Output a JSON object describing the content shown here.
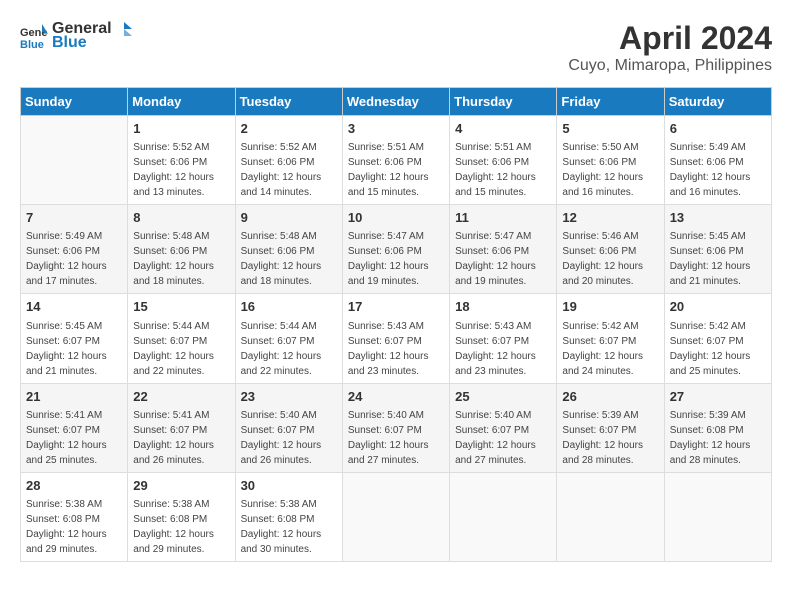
{
  "header": {
    "logo_general": "General",
    "logo_blue": "Blue",
    "title": "April 2024",
    "subtitle": "Cuyo, Mimaropa, Philippines"
  },
  "weekdays": [
    "Sunday",
    "Monday",
    "Tuesday",
    "Wednesday",
    "Thursday",
    "Friday",
    "Saturday"
  ],
  "weeks": [
    [
      {
        "day": "",
        "details": ""
      },
      {
        "day": "1",
        "details": "Sunrise: 5:52 AM\nSunset: 6:06 PM\nDaylight: 12 hours\nand 13 minutes."
      },
      {
        "day": "2",
        "details": "Sunrise: 5:52 AM\nSunset: 6:06 PM\nDaylight: 12 hours\nand 14 minutes."
      },
      {
        "day": "3",
        "details": "Sunrise: 5:51 AM\nSunset: 6:06 PM\nDaylight: 12 hours\nand 15 minutes."
      },
      {
        "day": "4",
        "details": "Sunrise: 5:51 AM\nSunset: 6:06 PM\nDaylight: 12 hours\nand 15 minutes."
      },
      {
        "day": "5",
        "details": "Sunrise: 5:50 AM\nSunset: 6:06 PM\nDaylight: 12 hours\nand 16 minutes."
      },
      {
        "day": "6",
        "details": "Sunrise: 5:49 AM\nSunset: 6:06 PM\nDaylight: 12 hours\nand 16 minutes."
      }
    ],
    [
      {
        "day": "7",
        "details": "Sunrise: 5:49 AM\nSunset: 6:06 PM\nDaylight: 12 hours\nand 17 minutes."
      },
      {
        "day": "8",
        "details": "Sunrise: 5:48 AM\nSunset: 6:06 PM\nDaylight: 12 hours\nand 18 minutes."
      },
      {
        "day": "9",
        "details": "Sunrise: 5:48 AM\nSunset: 6:06 PM\nDaylight: 12 hours\nand 18 minutes."
      },
      {
        "day": "10",
        "details": "Sunrise: 5:47 AM\nSunset: 6:06 PM\nDaylight: 12 hours\nand 19 minutes."
      },
      {
        "day": "11",
        "details": "Sunrise: 5:47 AM\nSunset: 6:06 PM\nDaylight: 12 hours\nand 19 minutes."
      },
      {
        "day": "12",
        "details": "Sunrise: 5:46 AM\nSunset: 6:06 PM\nDaylight: 12 hours\nand 20 minutes."
      },
      {
        "day": "13",
        "details": "Sunrise: 5:45 AM\nSunset: 6:06 PM\nDaylight: 12 hours\nand 21 minutes."
      }
    ],
    [
      {
        "day": "14",
        "details": "Sunrise: 5:45 AM\nSunset: 6:07 PM\nDaylight: 12 hours\nand 21 minutes."
      },
      {
        "day": "15",
        "details": "Sunrise: 5:44 AM\nSunset: 6:07 PM\nDaylight: 12 hours\nand 22 minutes."
      },
      {
        "day": "16",
        "details": "Sunrise: 5:44 AM\nSunset: 6:07 PM\nDaylight: 12 hours\nand 22 minutes."
      },
      {
        "day": "17",
        "details": "Sunrise: 5:43 AM\nSunset: 6:07 PM\nDaylight: 12 hours\nand 23 minutes."
      },
      {
        "day": "18",
        "details": "Sunrise: 5:43 AM\nSunset: 6:07 PM\nDaylight: 12 hours\nand 23 minutes."
      },
      {
        "day": "19",
        "details": "Sunrise: 5:42 AM\nSunset: 6:07 PM\nDaylight: 12 hours\nand 24 minutes."
      },
      {
        "day": "20",
        "details": "Sunrise: 5:42 AM\nSunset: 6:07 PM\nDaylight: 12 hours\nand 25 minutes."
      }
    ],
    [
      {
        "day": "21",
        "details": "Sunrise: 5:41 AM\nSunset: 6:07 PM\nDaylight: 12 hours\nand 25 minutes."
      },
      {
        "day": "22",
        "details": "Sunrise: 5:41 AM\nSunset: 6:07 PM\nDaylight: 12 hours\nand 26 minutes."
      },
      {
        "day": "23",
        "details": "Sunrise: 5:40 AM\nSunset: 6:07 PM\nDaylight: 12 hours\nand 26 minutes."
      },
      {
        "day": "24",
        "details": "Sunrise: 5:40 AM\nSunset: 6:07 PM\nDaylight: 12 hours\nand 27 minutes."
      },
      {
        "day": "25",
        "details": "Sunrise: 5:40 AM\nSunset: 6:07 PM\nDaylight: 12 hours\nand 27 minutes."
      },
      {
        "day": "26",
        "details": "Sunrise: 5:39 AM\nSunset: 6:07 PM\nDaylight: 12 hours\nand 28 minutes."
      },
      {
        "day": "27",
        "details": "Sunrise: 5:39 AM\nSunset: 6:08 PM\nDaylight: 12 hours\nand 28 minutes."
      }
    ],
    [
      {
        "day": "28",
        "details": "Sunrise: 5:38 AM\nSunset: 6:08 PM\nDaylight: 12 hours\nand 29 minutes."
      },
      {
        "day": "29",
        "details": "Sunrise: 5:38 AM\nSunset: 6:08 PM\nDaylight: 12 hours\nand 29 minutes."
      },
      {
        "day": "30",
        "details": "Sunrise: 5:38 AM\nSunset: 6:08 PM\nDaylight: 12 hours\nand 30 minutes."
      },
      {
        "day": "",
        "details": ""
      },
      {
        "day": "",
        "details": ""
      },
      {
        "day": "",
        "details": ""
      },
      {
        "day": "",
        "details": ""
      }
    ]
  ]
}
